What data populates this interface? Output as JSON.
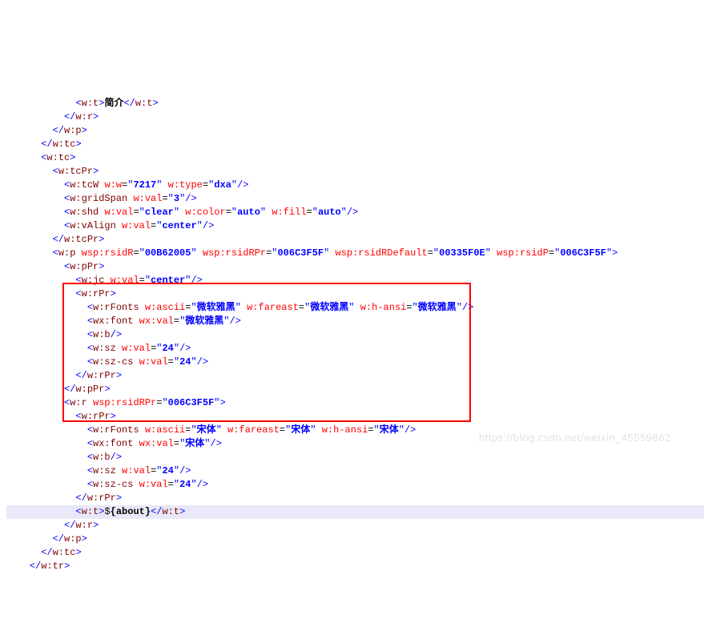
{
  "code": {
    "t1": "简介",
    "tcW_w": "7217",
    "tcW_type": "dxa",
    "gridSpan_val": "3",
    "shd_val": "clear",
    "shd_color": "auto",
    "shd_fill": "auto",
    "vAlign_val": "center",
    "p_rsidR": "00B62005",
    "p_rsidRPr": "006C3F5F",
    "p_rsidRDefault": "00335F0E",
    "p_rsidP": "006C3F5F",
    "jc_val": "center",
    "rFonts1_ascii": "微软雅黑",
    "rFonts1_fareast": "微软雅黑",
    "rFonts1_hansi": "微软雅黑",
    "wxfont1_val": "微软雅黑",
    "sz1_val": "24",
    "szcs1_val": "24",
    "r_rsidRPr": "006C3F5F",
    "rFonts2_ascii": "宋体",
    "rFonts2_fareast": "宋体",
    "rFonts2_hansi": "宋体",
    "wxfont2_val": "宋体",
    "sz2_val": "24",
    "szcs2_val": "24",
    "t2_pre": "$",
    "t2_bold": "{about}"
  },
  "watermark": "https://blog.csdn.net/weixin_45559862"
}
